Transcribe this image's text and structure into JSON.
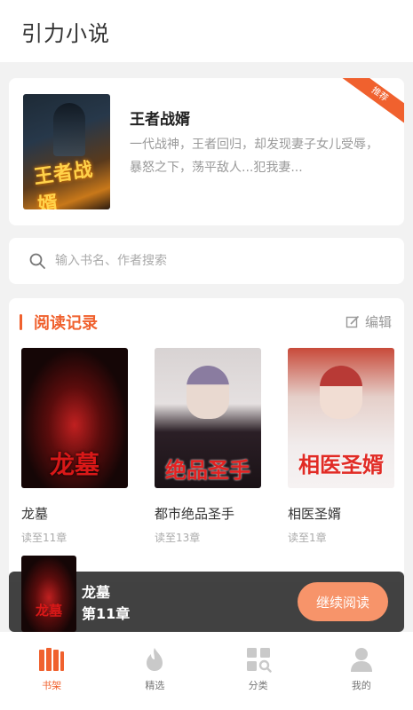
{
  "header": {
    "title": "引力小说"
  },
  "recommend": {
    "ribbon": "推荐",
    "title": "王者战婿",
    "description": "一代战神，王者回归，却发现妻子女儿受辱，暴怒之下，荡平敌人...犯我妻...",
    "cover_text": "王者战婿"
  },
  "search": {
    "placeholder": "输入书名、作者搜索"
  },
  "history": {
    "title": "阅读记录",
    "edit_label": "编辑",
    "books": [
      {
        "name": "龙墓",
        "progress": "读至11章",
        "cover_text": "龙墓"
      },
      {
        "name": "都市绝品圣手",
        "progress": "读至13章",
        "cover_text": "绝品圣手"
      },
      {
        "name": "相医圣婿",
        "progress": "读至1章",
        "cover_text": "相医圣婿"
      }
    ]
  },
  "mini_player": {
    "book": "龙墓",
    "chapter": "第11章",
    "cover_text": "龙墓",
    "button_label": "继续阅读"
  },
  "tabbar": {
    "items": [
      {
        "label": "书架",
        "icon": "bookshelf-icon",
        "active": true
      },
      {
        "label": "精选",
        "icon": "flame-icon",
        "active": false
      },
      {
        "label": "分类",
        "icon": "category-icon",
        "active": false
      },
      {
        "label": "我的",
        "icon": "user-icon",
        "active": false
      }
    ]
  },
  "colors": {
    "accent": "#f0612e",
    "button": "#f7946a"
  }
}
